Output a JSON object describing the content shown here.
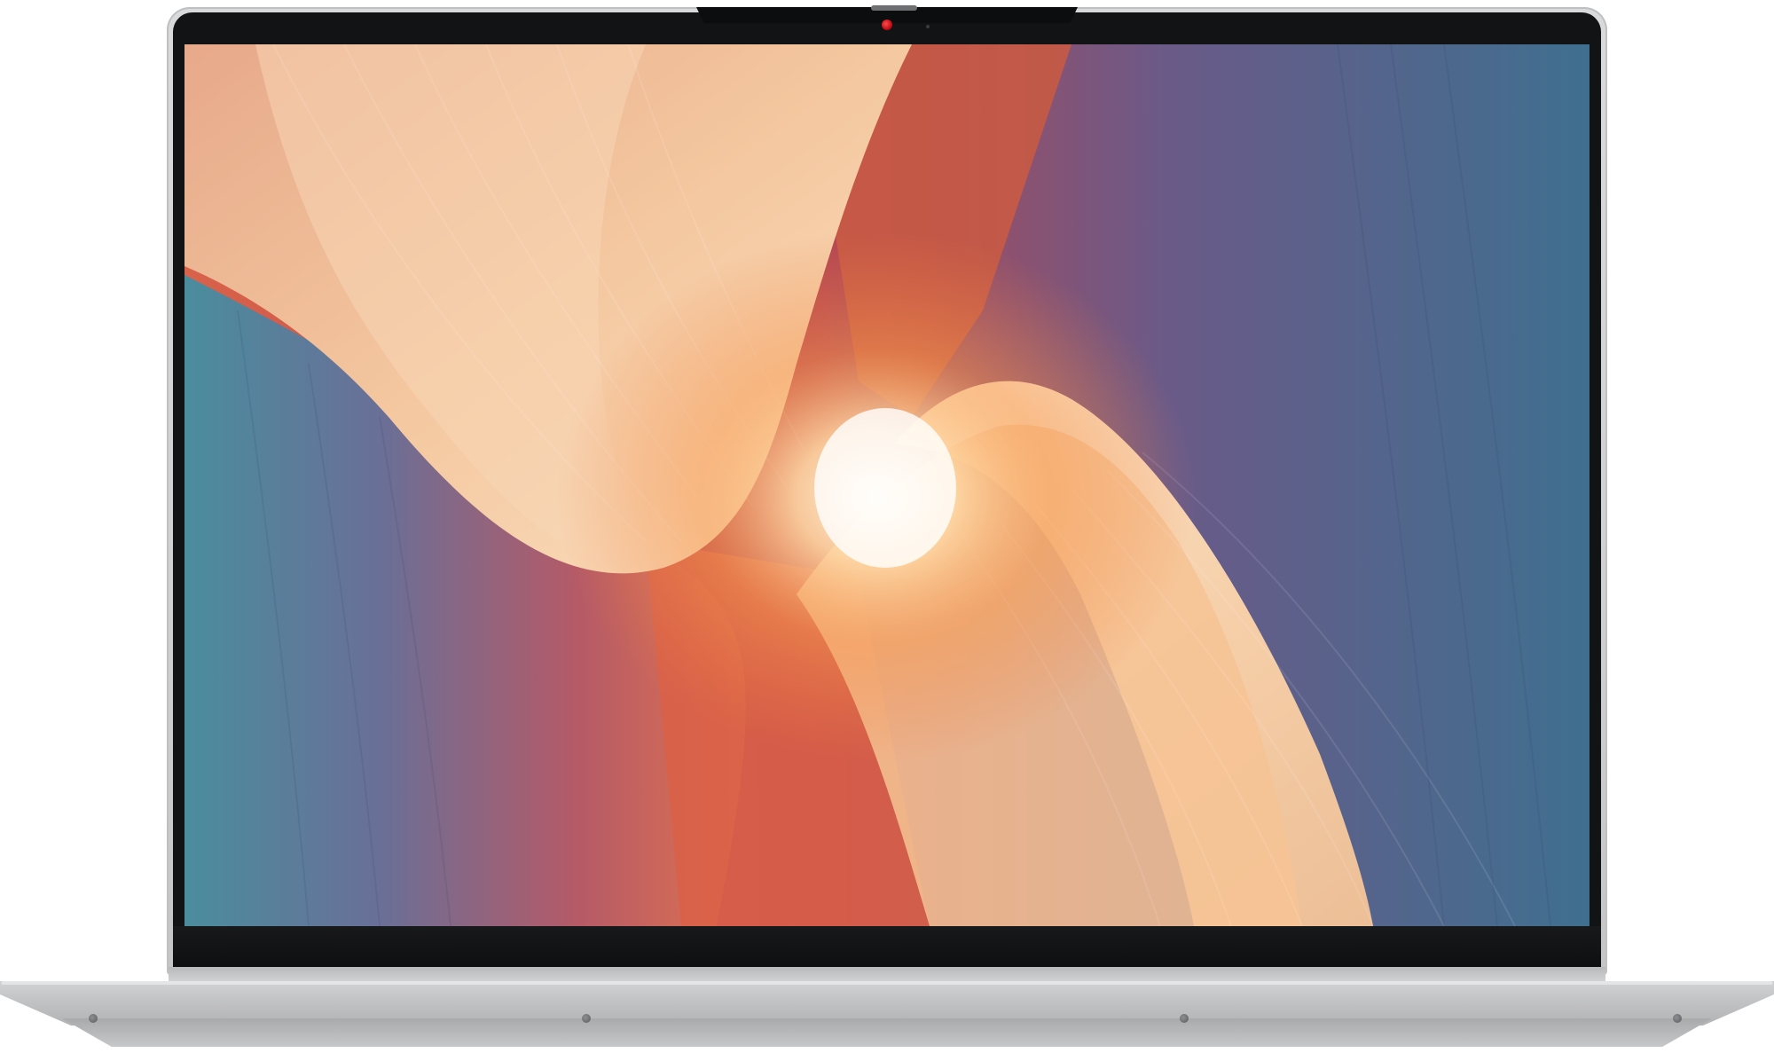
{
  "image": {
    "subject": "laptop",
    "colors": {
      "chassis": "#cfd0d2",
      "bezel": "#121314",
      "webcam_indicator": "#d41520",
      "wallpaper_warm": "#f6b07a",
      "wallpaper_red": "#c0393f",
      "wallpaper_blue": "#3a6d94",
      "wallpaper_teal": "#5b9aa6",
      "wallpaper_cream": "#f5d0a8"
    },
    "icons": [
      "webcam-icon",
      "sensor-icon"
    ]
  }
}
